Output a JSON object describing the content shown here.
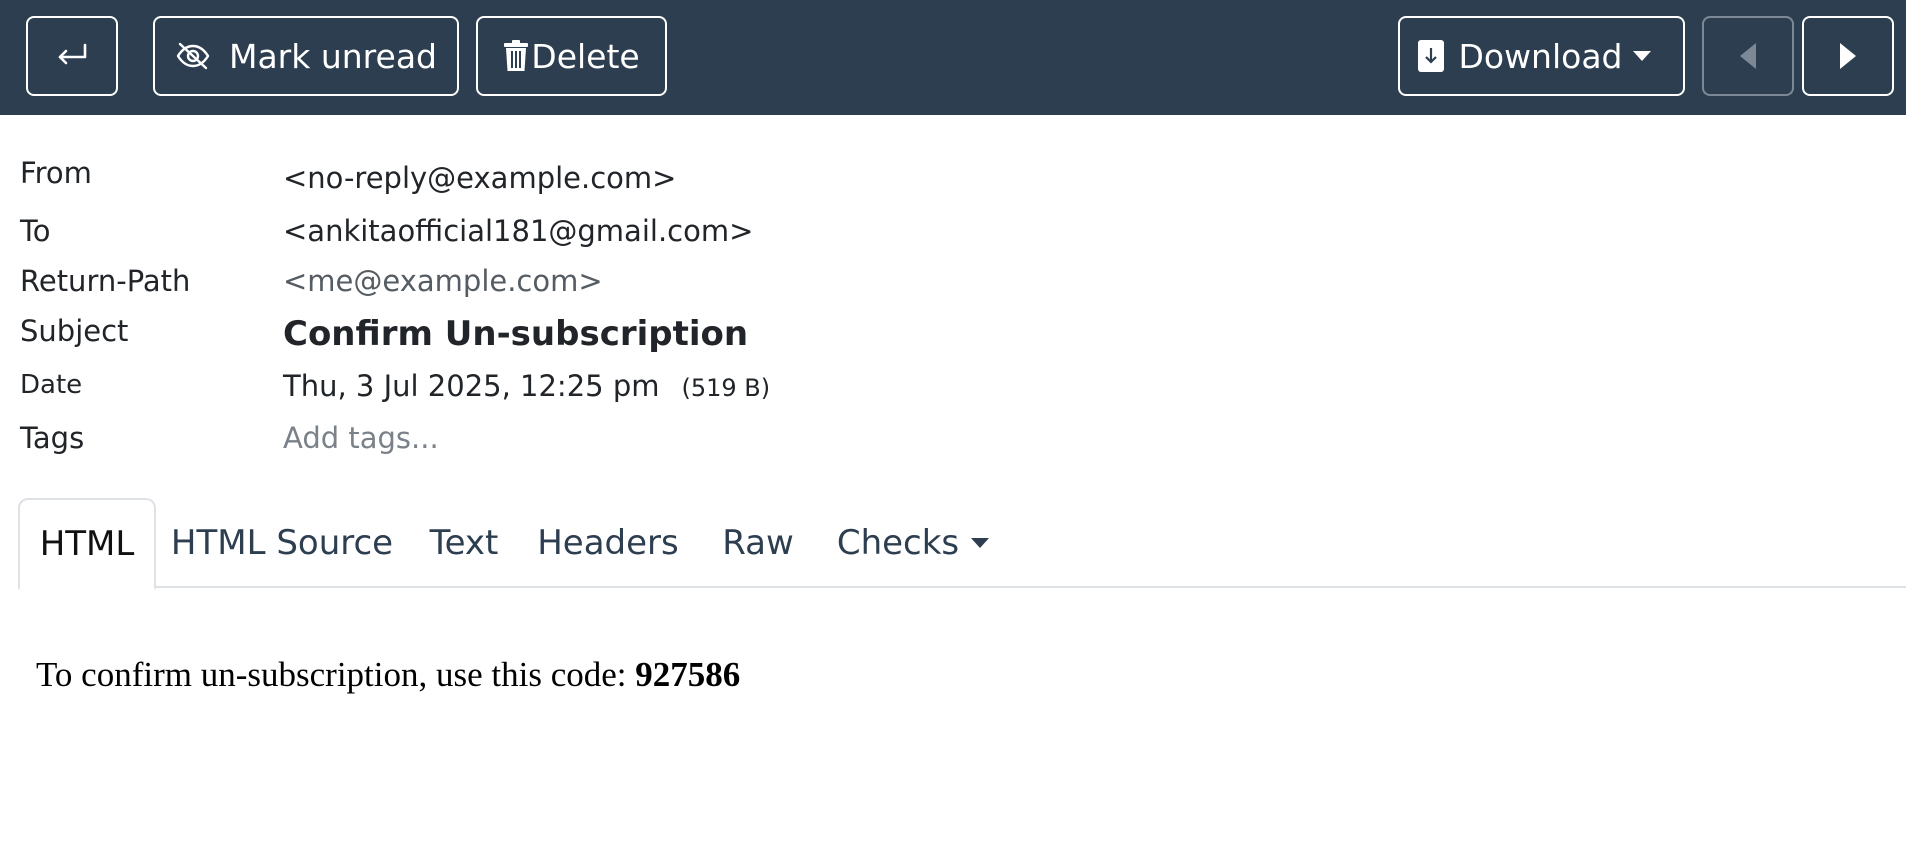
{
  "toolbar": {
    "back": {
      "icon": "return-arrow-icon"
    },
    "mark_unread": {
      "label": "Mark unread",
      "icon": "eye-slash-icon"
    },
    "delete": {
      "label": "Delete",
      "icon": "trash-icon"
    },
    "download": {
      "label": "Download",
      "icon": "file-download-icon"
    },
    "prev": {
      "icon": "caret-left-icon",
      "disabled": true
    },
    "next": {
      "icon": "caret-right-icon"
    },
    "background": "#2d3e50"
  },
  "headers": {
    "from": {
      "label": "From",
      "value": "<no-reply@example.com>"
    },
    "to": {
      "label": "To",
      "value": "<ankitaofficial181@gmail.com>"
    },
    "return_path": {
      "label": "Return-Path",
      "value": "<me@example.com>"
    },
    "subject": {
      "label": "Subject",
      "value": "Confirm Un-subscription"
    },
    "date": {
      "label": "Date",
      "value": "Thu, 3 Jul 2025, 12:25 pm",
      "size": "(519 B)"
    },
    "tags": {
      "label": "Tags",
      "placeholder": "Add tags..."
    }
  },
  "tabs": [
    {
      "label": "HTML",
      "active": true
    },
    {
      "label": "HTML Source",
      "active": false
    },
    {
      "label": "Text",
      "active": false
    },
    {
      "label": "Headers",
      "active": false
    },
    {
      "label": "Raw",
      "active": false
    },
    {
      "label": "Checks",
      "active": false,
      "dropdown": true
    }
  ],
  "message": {
    "text": "To confirm un-subscription, use this code: ",
    "code": "927586"
  }
}
